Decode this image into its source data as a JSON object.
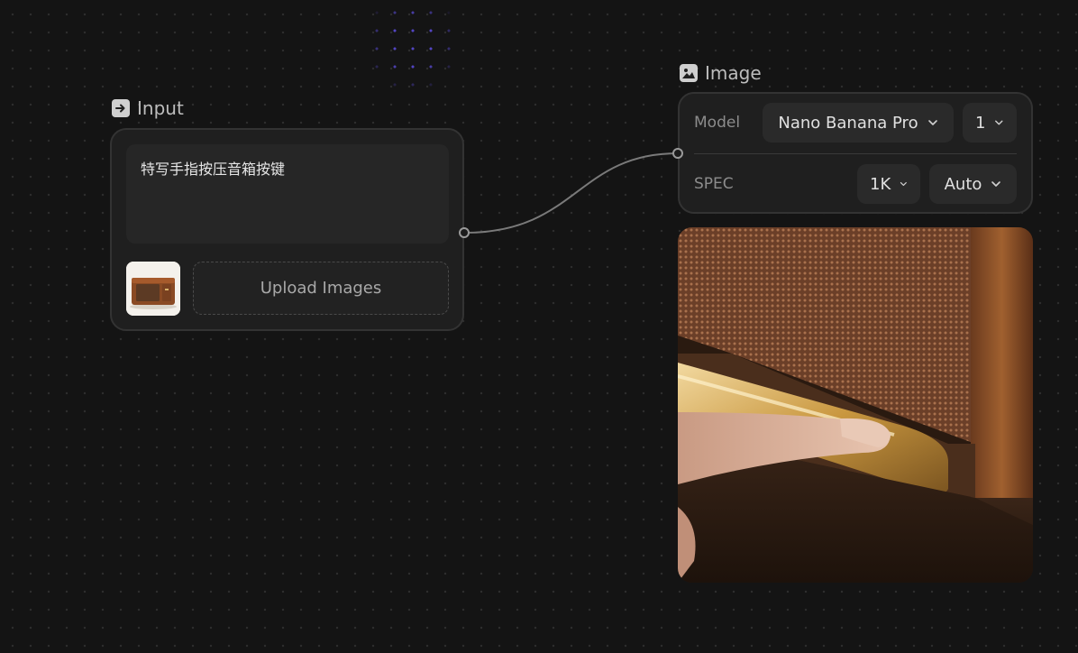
{
  "input_node": {
    "title": "Input",
    "prompt": "特写手指按压音箱按键",
    "upload_label": "Upload Images"
  },
  "image_node": {
    "title": "Image",
    "model_label": "Model",
    "model_value": "Nano Banana Pro",
    "count_value": "1",
    "spec_label": "SPEC",
    "resolution_value": "1K",
    "ratio_value": "Auto"
  },
  "icons": {
    "input": "arrow-right-icon",
    "image": "image-icon",
    "dropdown": "chevron-down-icon"
  },
  "colors": {
    "background": "#141414",
    "card": "#1f1f1f",
    "accent_dots": "#5a4bd6"
  }
}
